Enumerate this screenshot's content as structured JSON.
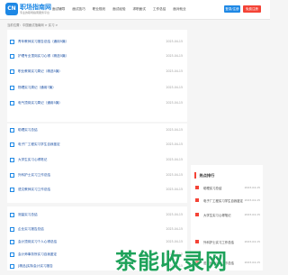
{
  "header": {
    "logo_mark": "CN",
    "logo_title": "职场指南网",
    "logo_sub": "专业的职场指南服务平台",
    "nav": [
      "面试辅导",
      "面试技巧",
      "职业规划",
      "面试经验",
      "求职面试",
      "工作总结",
      "面对就业"
    ],
    "login_label": "登录/注册",
    "register_label": "免费注册"
  },
  "breadcrumb": "当前位置：中国面试指南网 > 实习 >",
  "list_groups": [
    {
      "items": [
        {
          "title": "青年教师实习报告总结（通用5篇）",
          "date": "2023-04-15"
        },
        {
          "title": "护理专业顶岗实习心得（精选5篇）",
          "date": "2023-04-15"
        },
        {
          "title": "职业教育实习周记（精选5篇）",
          "date": "2023-04-15"
        },
        {
          "title": "物理实习周记（通用7篇）",
          "date": "2023-04-15"
        },
        {
          "title": "电气顶岗实习周记（通用5篇）",
          "date": "2023-04-15"
        }
      ]
    },
    {
      "items": [
        {
          "title": "助理实习总结",
          "date": "2023-04-15"
        },
        {
          "title": "电子厂工程实习学生自我鉴定",
          "date": "2023-04-15"
        },
        {
          "title": "大学生实习心得笔记",
          "date": "2023-04-15"
        },
        {
          "title": "外科护士实习工作总结",
          "date": "2023-04-15"
        },
        {
          "title": "语文教师实习工作总结",
          "date": "2023-04-15"
        }
      ]
    },
    {
      "items": [
        {
          "title": "测量实习总结",
          "date": "2023-04-15"
        },
        {
          "title": "企业实习报告总结",
          "date": "2023-04-15"
        },
        {
          "title": "会计顶岗实习个人心得总结",
          "date": "2023-04-15"
        },
        {
          "title": "会计师事务所实习自我鉴定",
          "date": "2023-04-15"
        },
        {
          "title": "[精品]实际会计实习报告",
          "date": "2023-04-15"
        }
      ]
    }
  ],
  "sidebar": {
    "title": "热点排行",
    "items": [
      {
        "title": "助理实习总结",
        "date": "2023-04-15"
      },
      {
        "title": "电子厂工程实习学生自我鉴定",
        "date": "2023-04-15"
      },
      {
        "title": "大学生实习心得笔记",
        "date": "2023-04-15"
      },
      {
        "title": "外科护士实习工作总结",
        "date": "2023-04-15"
      },
      {
        "title": "语文教师实习工作总结",
        "date": "2023-04-15"
      }
    ]
  },
  "watermark": "茶能收录网"
}
